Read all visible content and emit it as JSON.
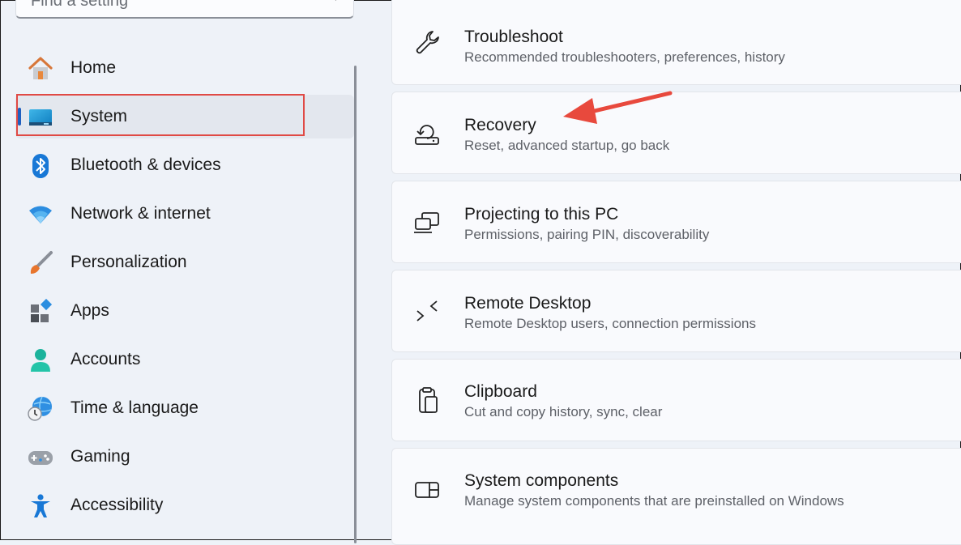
{
  "search": {
    "placeholder": "Find a setting"
  },
  "sidebar": {
    "items": [
      {
        "label": "Home",
        "icon": "home-icon"
      },
      {
        "label": "System",
        "icon": "system-icon",
        "selected": true
      },
      {
        "label": "Bluetooth & devices",
        "icon": "bluetooth-icon"
      },
      {
        "label": "Network & internet",
        "icon": "wifi-icon"
      },
      {
        "label": "Personalization",
        "icon": "brush-icon"
      },
      {
        "label": "Apps",
        "icon": "apps-icon"
      },
      {
        "label": "Accounts",
        "icon": "account-icon"
      },
      {
        "label": "Time & language",
        "icon": "globe-clock-icon"
      },
      {
        "label": "Gaming",
        "icon": "gamepad-icon"
      },
      {
        "label": "Accessibility",
        "icon": "accessibility-icon"
      }
    ]
  },
  "main": {
    "cards": [
      {
        "title": "Troubleshoot",
        "desc": "Recommended troubleshooters, preferences, history",
        "icon": "wrench-icon"
      },
      {
        "title": "Recovery",
        "desc": "Reset, advanced startup, go back",
        "icon": "recovery-icon"
      },
      {
        "title": "Projecting to this PC",
        "desc": "Permissions, pairing PIN, discoverability",
        "icon": "projecting-icon"
      },
      {
        "title": "Remote Desktop",
        "desc": "Remote Desktop users, connection permissions",
        "icon": "remote-desktop-icon"
      },
      {
        "title": "Clipboard",
        "desc": "Cut and copy history, sync, clear",
        "icon": "clipboard-icon"
      },
      {
        "title": "System components",
        "desc": "Manage system components that are preinstalled on Windows",
        "icon": "system-components-icon"
      }
    ]
  },
  "colors": {
    "accent": "#1f5fbf",
    "annotation": "#e04a45",
    "background": "#eef2f8",
    "card": "#f9fafd"
  }
}
